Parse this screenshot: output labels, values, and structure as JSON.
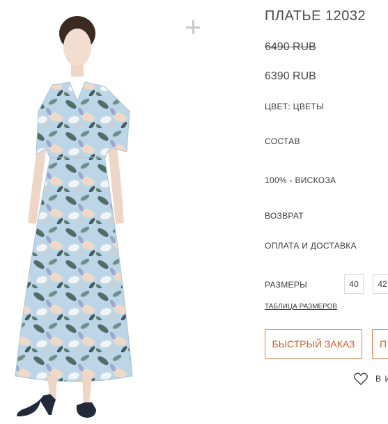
{
  "product": {
    "title": "ПЛАТЬЕ 12032",
    "old_price": "6490 RUB",
    "new_price": "6390 RUB",
    "color_line": "ЦВЕТ: ЦВЕТЫ",
    "composition_heading": "СОСТАВ",
    "composition_value": "100% - ВИСКОЗА",
    "returns_heading": "ВОЗВРАТ",
    "payment_heading": "ОПЛАТА И ДОСТАВКА"
  },
  "sizes": {
    "label": "РАЗМЕРЫ",
    "options": [
      "40",
      "42"
    ],
    "table_link": "ТАБЛИЦА РАЗМЕРОВ"
  },
  "actions": {
    "quick_order": "БЫСТРЫЙ ЗАКАЗ",
    "second_button": "П",
    "wishlist": "В И",
    "wishlist_icon": "heart-icon",
    "zoom_icon": "plus-icon"
  },
  "colors": {
    "accent": "#d8602c",
    "dress": "#b9d3e6"
  }
}
